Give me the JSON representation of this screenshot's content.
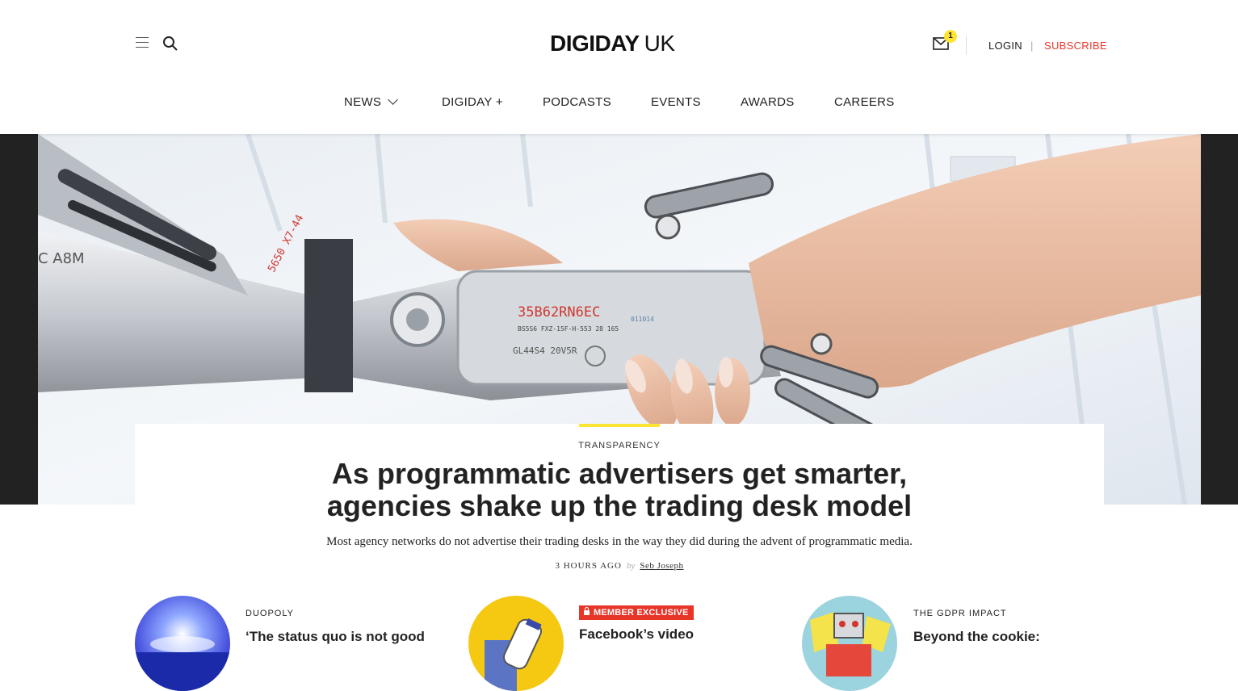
{
  "header": {
    "logo_brand": "DIGIDAY",
    "logo_region": "UK",
    "notification_count": "1",
    "login_label": "LOGIN",
    "separator": "|",
    "subscribe_label": "SUBSCRIBE"
  },
  "nav": {
    "items": [
      {
        "label": "NEWS",
        "has_dropdown": true
      },
      {
        "label": "DIGIDAY +"
      },
      {
        "label": "PODCASTS"
      },
      {
        "label": "EVENTS"
      },
      {
        "label": "AWARDS"
      },
      {
        "label": "CAREERS"
      }
    ]
  },
  "hero": {
    "image_texts": [
      "5650 X7-44",
      "C A8M",
      "35B62RN6EC",
      "011014",
      "BS5S6 FXZ-15F-H-553 28 165",
      "GL44S4 20V5R"
    ],
    "kicker": "TRANSPARENCY",
    "headline_line1": "As programmatic advertisers get smarter,",
    "headline_line2": "agencies shake up the trading desk model",
    "dek": "Most agency networks do not advertise their trading desks in the way they did during the advent of programmatic media.",
    "time": "3 HOURS AGO",
    "by": "by",
    "author": "Seb Joseph"
  },
  "stories": [
    {
      "kicker": "DUOPOLY",
      "title": "‘The status quo is not good"
    },
    {
      "badge": "MEMBER EXCLUSIVE",
      "title": "Facebook’s video"
    },
    {
      "kicker": "THE GDPR IMPACT",
      "title": "Beyond the cookie:"
    }
  ],
  "colors": {
    "accent_yellow": "#ffe432",
    "subscribe_red": "#e8352a",
    "text": "#222222"
  }
}
